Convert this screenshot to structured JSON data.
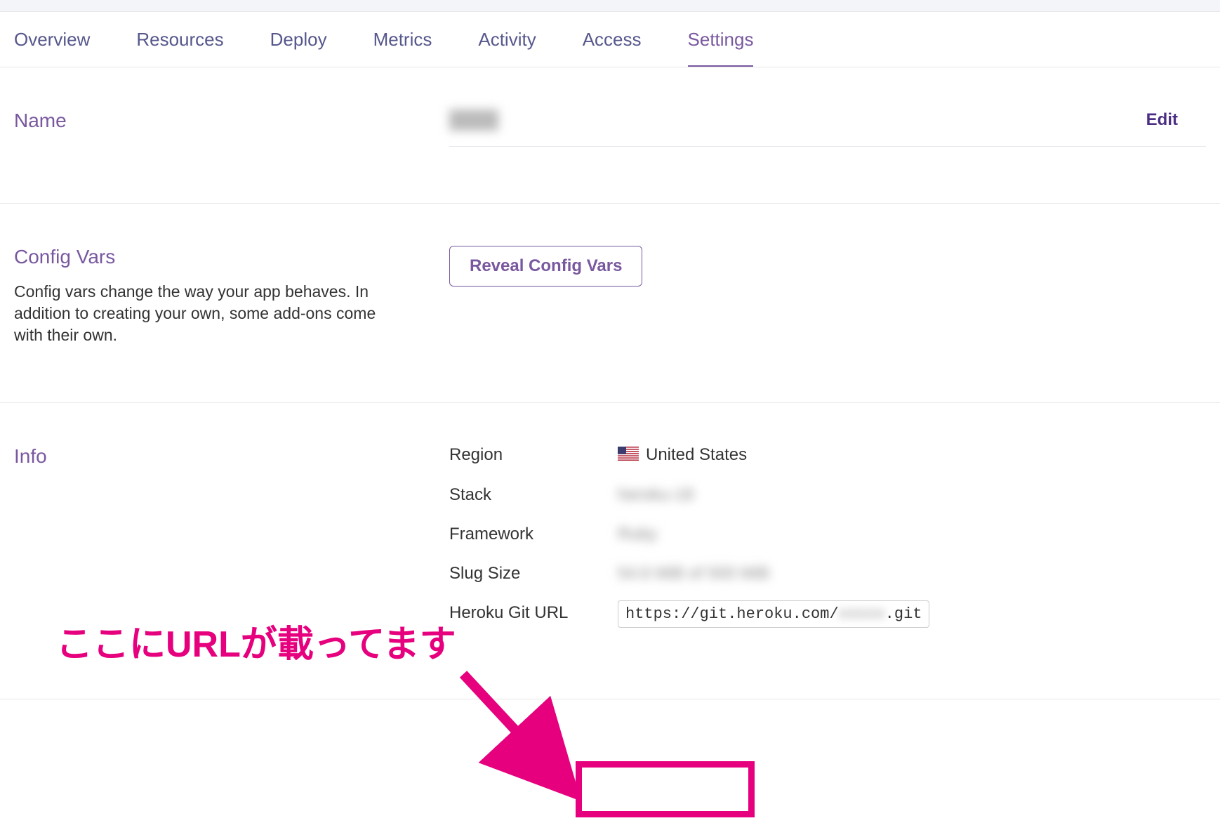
{
  "tabs": {
    "overview": "Overview",
    "resources": "Resources",
    "deploy": "Deploy",
    "metrics": "Metrics",
    "activity": "Activity",
    "access": "Access",
    "settings": "Settings"
  },
  "name_section": {
    "title": "Name",
    "edit": "Edit"
  },
  "config_section": {
    "title": "Config Vars",
    "description": "Config vars change the way your app behaves. In addition to creating your own, some add-ons come with their own.",
    "button": "Reveal Config Vars"
  },
  "info_section": {
    "title": "Info",
    "rows": {
      "region": {
        "label": "Region",
        "value": "United States"
      },
      "stack": {
        "label": "Stack",
        "value": "heroku-18"
      },
      "framework": {
        "label": "Framework",
        "value": "Ruby"
      },
      "slug": {
        "label": "Slug Size",
        "value": "54.6 MiB of 500 MiB"
      },
      "git": {
        "label": "Heroku Git URL",
        "url_prefix": "https://git.heroku.com/",
        "url_hidden": "xxxxx",
        "url_suffix": ".git"
      }
    }
  },
  "annotation": {
    "text": "ここにURLが載ってます"
  }
}
